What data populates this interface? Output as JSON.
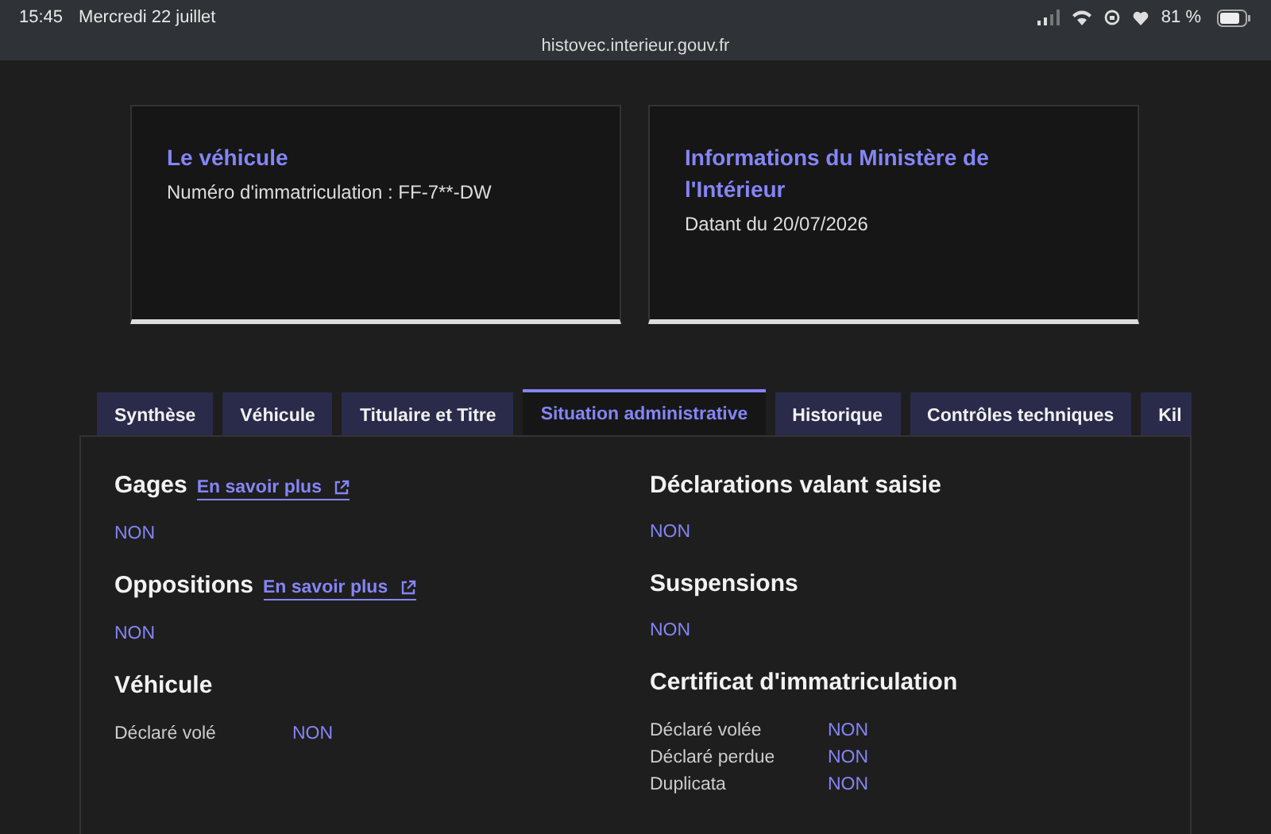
{
  "status_bar": {
    "time": "15:45",
    "date": "Mercredi 22 juillet",
    "battery": "81 %",
    "url": "histovec.interieur.gouv.fr"
  },
  "cards": [
    {
      "title": "Le véhicule",
      "text": "Numéro d'immatriculation : FF-7**-DW"
    },
    {
      "title": "Informations du Ministère de l'Intérieur",
      "text": "Datant du 20/07/2026"
    }
  ],
  "tabs": [
    {
      "label": "Synthèse",
      "selected": false
    },
    {
      "label": "Véhicule",
      "selected": false
    },
    {
      "label": "Titulaire et Titre",
      "selected": false
    },
    {
      "label": "Situation administrative",
      "selected": true
    },
    {
      "label": "Historique",
      "selected": false
    },
    {
      "label": "Contrôles techniques",
      "selected": false
    },
    {
      "label": "Kil",
      "selected": false
    }
  ],
  "columns": [
    [
      {
        "kind": "value",
        "title": "Gages",
        "link": "En savoir plus",
        "value": "NON"
      },
      {
        "kind": "value",
        "title": "Oppositions",
        "link": "En savoir plus",
        "value": "NON"
      },
      {
        "kind": "rows",
        "title": "Véhicule",
        "rows": [
          {
            "label": "Déclaré volé",
            "value": "NON"
          }
        ]
      }
    ],
    [
      {
        "kind": "value",
        "title": "Déclarations valant saisie",
        "value": "NON"
      },
      {
        "kind": "value",
        "title": "Suspensions",
        "value": "NON"
      },
      {
        "kind": "rows",
        "title": "Certificat d'immatriculation",
        "rows": [
          {
            "label": "Déclaré volée",
            "value": "NON"
          },
          {
            "label": "Déclaré perdue",
            "value": "NON"
          },
          {
            "label": "Duplicata",
            "value": "NON"
          }
        ]
      }
    ]
  ]
}
